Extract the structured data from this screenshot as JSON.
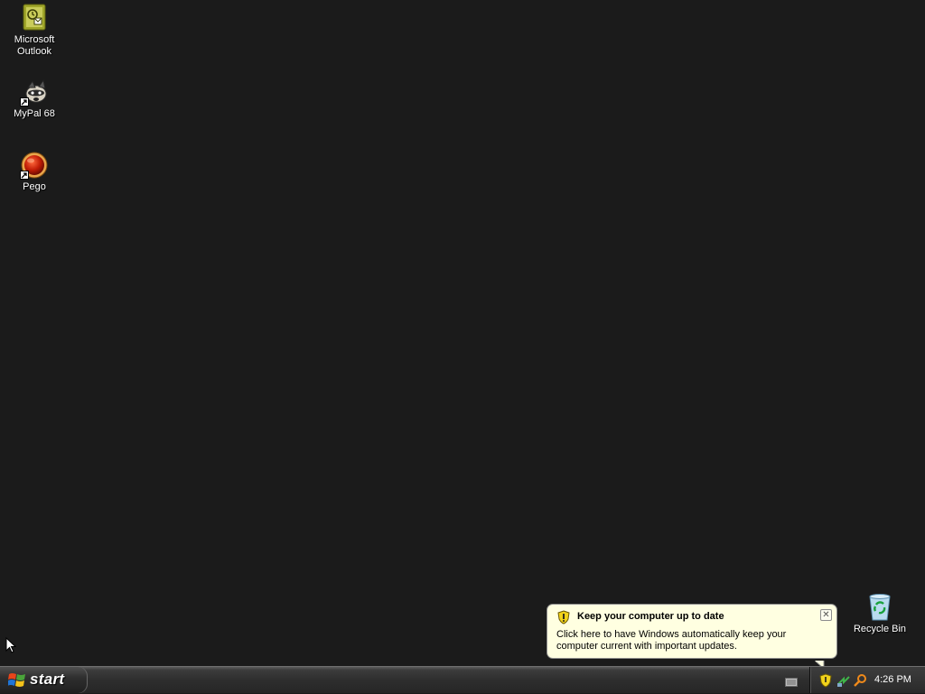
{
  "desktop": {
    "icons": [
      {
        "label": "Microsoft\nOutlook",
        "icon": "outlook-icon"
      },
      {
        "label": "MyPal 68",
        "icon": "mypal-icon"
      },
      {
        "label": "Pego",
        "icon": "pego-icon"
      },
      {
        "label": "Recycle Bin",
        "icon": "recycle-bin-icon"
      }
    ],
    "background_color": "#1b1b1b"
  },
  "balloon": {
    "title": "Keep your computer up to date",
    "text": "Click here to have Windows automatically keep your computer current with important updates.",
    "close_symbol": "✕",
    "icon": "security-shield-icon",
    "background_color": "#ffffe1"
  },
  "taskbar": {
    "start_label": "start",
    "tray_icons": [
      "security-shield-icon",
      "network-icon",
      "search-icon"
    ],
    "clock": "4:26 PM"
  }
}
